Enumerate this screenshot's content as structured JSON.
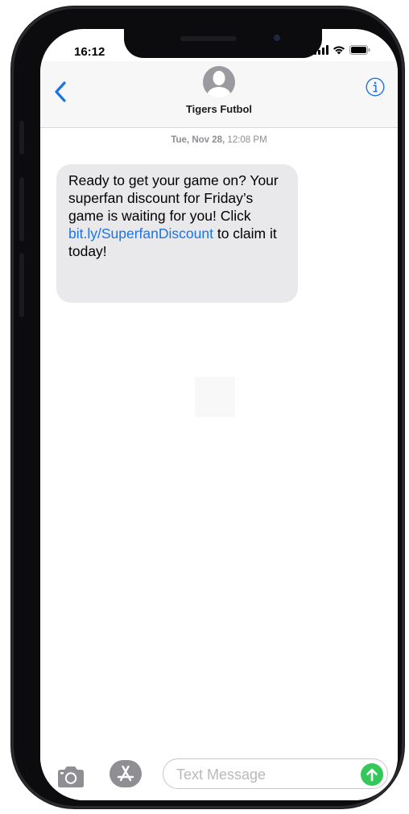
{
  "status_bar": {
    "time": "16:12"
  },
  "header": {
    "contact_name": "Tigers Futbol"
  },
  "thread": {
    "timestamp_day": "Tue, Nov 28,",
    "timestamp_time": " 12:08 PM",
    "message": {
      "text_before_link": "Ready to get your game on? Your superfan discount for Friday’s game is waiting for you! Click ",
      "link": "bit.ly/SuperfanDiscount",
      "text_after_link": " to claim it today!"
    }
  },
  "composer": {
    "placeholder": "Text Message"
  },
  "colors": {
    "accent": "#1b74e4",
    "bubble_incoming": "#e9e9eb",
    "send_button": "#34c759"
  },
  "icons": {
    "back": "chevron-left-icon",
    "info": "info-icon",
    "camera": "camera-icon",
    "app_store": "app-store-icon",
    "send": "arrow-up-icon"
  }
}
